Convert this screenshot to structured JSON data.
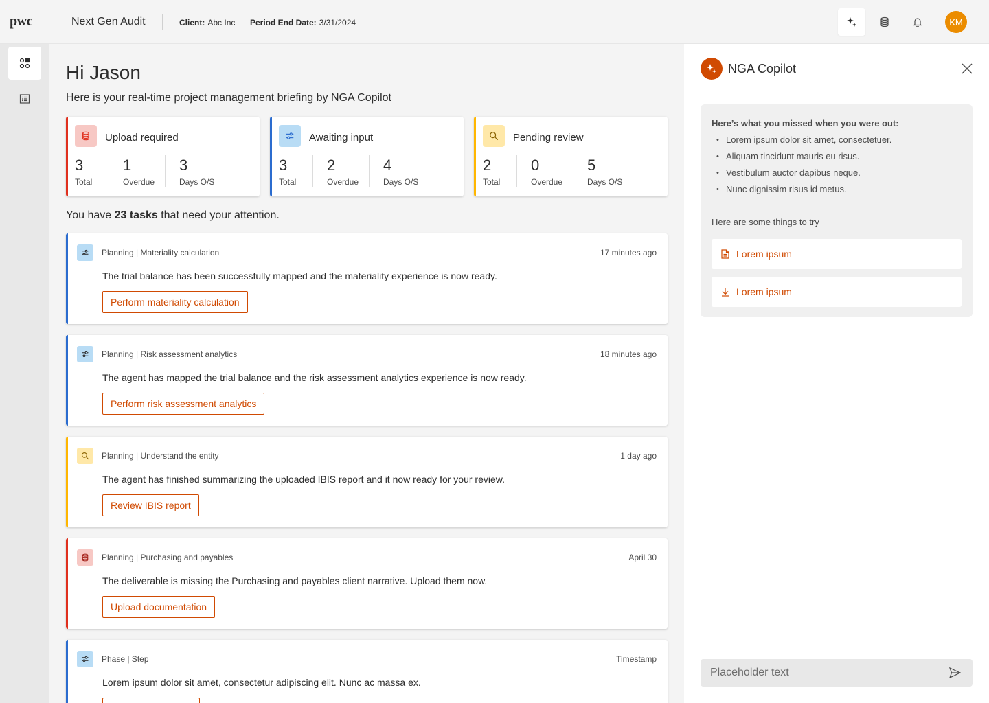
{
  "header": {
    "logo": "pwc",
    "app_name": "Next Gen Audit",
    "client_label": "Client:",
    "client_value": "Abc Inc",
    "period_label": "Period End Date:",
    "period_value": "3/31/2024",
    "avatar_initials": "KM",
    "icons": [
      "sparkle-icon",
      "database-icon",
      "bell-icon"
    ]
  },
  "rail": {
    "items": [
      {
        "icon": "dashboard-icon",
        "active": true
      },
      {
        "icon": "list-icon",
        "active": false
      }
    ]
  },
  "main": {
    "greeting": "Hi Jason",
    "subtitle": "Here is your real-time project management briefing by NGA Copilot",
    "stat_cards": [
      {
        "title": "Upload required",
        "icon": "database-icon",
        "color": "#e0301e",
        "icon_bg": "#f7c8c4",
        "total": "3",
        "total_label": "Total",
        "overdue": "1",
        "overdue_label": "Overdue",
        "days": "3",
        "days_label": "Days O/S"
      },
      {
        "title": "Awaiting input",
        "icon": "sliders-icon",
        "color": "#2b6ccf",
        "icon_bg": "#b8dcf5",
        "total": "3",
        "total_label": "Total",
        "overdue": "2",
        "overdue_label": "Overdue",
        "days": "4",
        "days_label": "Days O/S"
      },
      {
        "title": "Pending review",
        "icon": "search-icon",
        "color": "#ffb600",
        "icon_bg": "#ffe8a8",
        "total": "2",
        "total_label": "Total",
        "overdue": "0",
        "overdue_label": "Overdue",
        "days": "5",
        "days_label": "Days O/S"
      }
    ],
    "tasks_prefix": "You have ",
    "tasks_count": "23 tasks",
    "tasks_suffix": " that need your attention.",
    "tasks": [
      {
        "crumb": "Planning | Materiality calculation",
        "time": "17 minutes ago",
        "desc": "The trial balance has been successfully mapped and the materiality experience is now ready.",
        "action": "Perform materiality calculation",
        "icon": "sliders-icon",
        "color": "#2b6ccf",
        "icon_bg": "#b8dcf5"
      },
      {
        "crumb": "Planning | Risk assessment analytics",
        "time": "18 minutes ago",
        "desc": "The agent has mapped the trial balance and the risk assessment analytics experience is now ready.",
        "action": "Perform risk assessment analytics",
        "icon": "sliders-icon",
        "color": "#2b6ccf",
        "icon_bg": "#b8dcf5"
      },
      {
        "crumb": "Planning | Understand the entity",
        "time": "1 day ago",
        "desc": "The agent has finished summarizing the uploaded IBIS report and it now ready for your review.",
        "action": "Review IBIS report",
        "icon": "search-icon",
        "color": "#ffb600",
        "icon_bg": "#ffe8a8"
      },
      {
        "crumb": "Planning | Purchasing and payables",
        "time": "April 30",
        "desc": "The deliverable is missing the Purchasing and payables client narrative. Upload them now.",
        "action": "Upload documentation",
        "icon": "database-icon",
        "color": "#e0301e",
        "icon_bg": "#f7c8c4"
      },
      {
        "crumb": "Phase | Step",
        "time": "Timestamp",
        "desc": "Lorem ipsum dolor sit amet, consectetur adipiscing elit. Nunc ac massa ex.",
        "action": "",
        "icon": "sliders-icon",
        "color": "#2b6ccf",
        "icon_bg": "#b8dcf5"
      }
    ]
  },
  "copilot": {
    "title": "NGA Copilot",
    "missed_heading": "Here’s what you missed when you were out:",
    "missed_items": [
      "Lorem ipsum dolor sit amet, consectetuer.",
      "Aliquam tincidunt mauris eu risus.",
      "Vestibulum auctor dapibus neque.",
      "Nunc dignissim risus id metus."
    ],
    "try_heading": "Here are some things to try",
    "suggestions": [
      {
        "label": "Lorem ipsum",
        "icon": "document-icon"
      },
      {
        "label": "Lorem ipsum",
        "icon": "download-icon"
      }
    ],
    "input_placeholder": "Placeholder text"
  }
}
